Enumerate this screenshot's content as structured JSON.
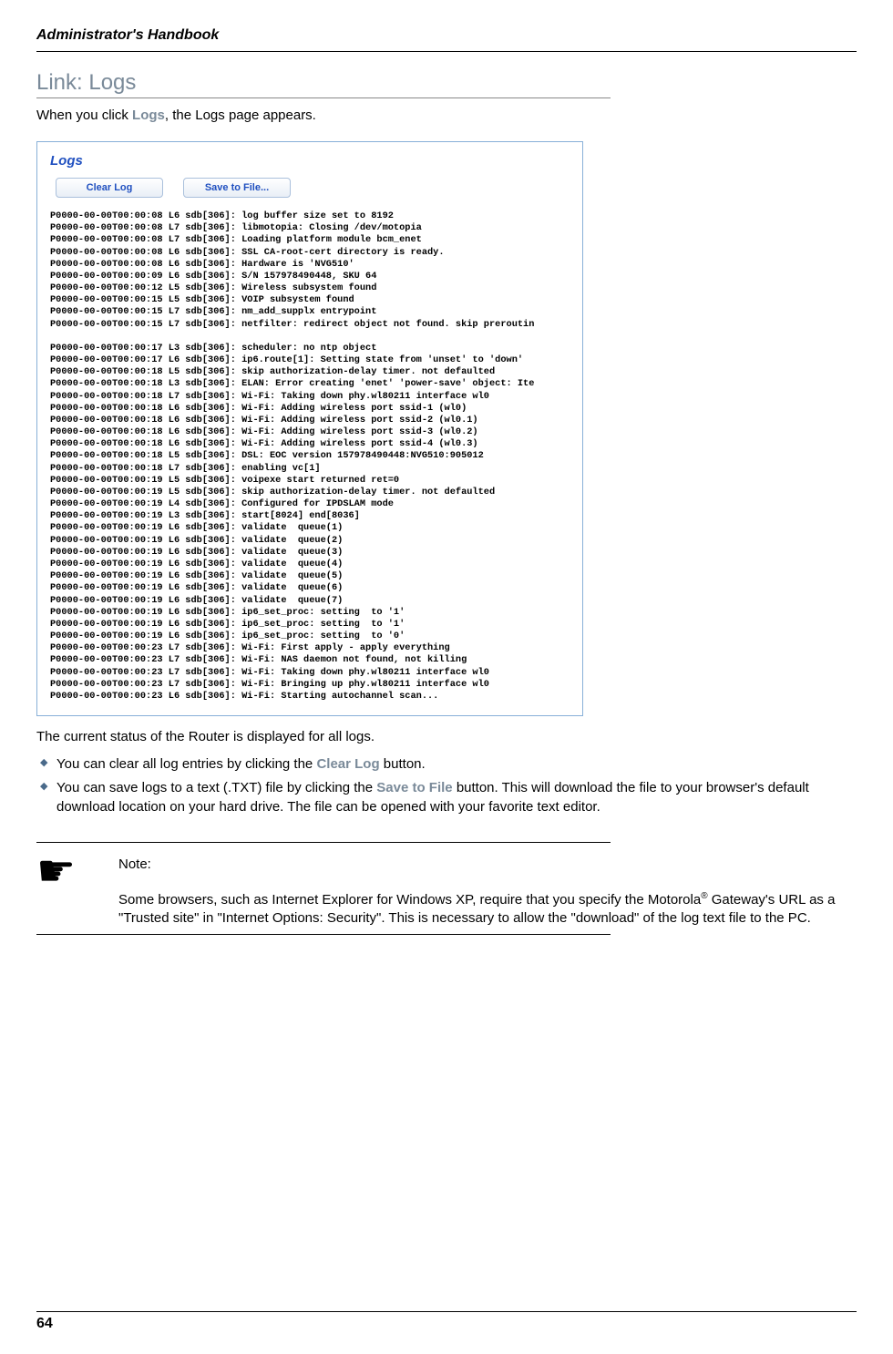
{
  "header": {
    "title": "Administrator's Handbook"
  },
  "section": {
    "heading": "Link: Logs",
    "intro_prefix": "When you click ",
    "intro_link": "Logs",
    "intro_suffix": ", the Logs page appears."
  },
  "screenshot": {
    "title": "Logs",
    "buttons": {
      "clear": "Clear Log",
      "save": "Save to File..."
    },
    "log_text": "P0000-00-00T00:00:08 L6 sdb[306]: log buffer size set to 8192\nP0000-00-00T00:00:08 L7 sdb[306]: libmotopia: Closing /dev/motopia\nP0000-00-00T00:00:08 L7 sdb[306]: Loading platform module bcm_enet\nP0000-00-00T00:00:08 L6 sdb[306]: SSL CA-root-cert directory is ready.\nP0000-00-00T00:00:08 L6 sdb[306]: Hardware is 'NVG510'\nP0000-00-00T00:00:09 L6 sdb[306]: S/N 157978490448, SKU 64\nP0000-00-00T00:00:12 L5 sdb[306]: Wireless subsystem found\nP0000-00-00T00:00:15 L5 sdb[306]: VOIP subsystem found\nP0000-00-00T00:00:15 L7 sdb[306]: nm_add_supplx entrypoint\nP0000-00-00T00:00:15 L7 sdb[306]: netfilter: redirect object not found. skip preroutin\n\nP0000-00-00T00:00:17 L3 sdb[306]: scheduler: no ntp object\nP0000-00-00T00:00:17 L6 sdb[306]: ip6.route[1]: Setting state from 'unset' to 'down'\nP0000-00-00T00:00:18 L5 sdb[306]: skip authorization-delay timer. not defaulted\nP0000-00-00T00:00:18 L3 sdb[306]: ELAN: Error creating 'enet' 'power-save' object: Ite\nP0000-00-00T00:00:18 L7 sdb[306]: Wi-Fi: Taking down phy.wl80211 interface wl0\nP0000-00-00T00:00:18 L6 sdb[306]: Wi-Fi: Adding wireless port ssid-1 (wl0)\nP0000-00-00T00:00:18 L6 sdb[306]: Wi-Fi: Adding wireless port ssid-2 (wl0.1)\nP0000-00-00T00:00:18 L6 sdb[306]: Wi-Fi: Adding wireless port ssid-3 (wl0.2)\nP0000-00-00T00:00:18 L6 sdb[306]: Wi-Fi: Adding wireless port ssid-4 (wl0.3)\nP0000-00-00T00:00:18 L5 sdb[306]: DSL: EOC version 157978490448:NVG510:905012\nP0000-00-00T00:00:18 L7 sdb[306]: enabling vc[1]\nP0000-00-00T00:00:19 L5 sdb[306]: voipexe start returned ret=0\nP0000-00-00T00:00:19 L5 sdb[306]: skip authorization-delay timer. not defaulted\nP0000-00-00T00:00:19 L4 sdb[306]: Configured for IPDSLAM mode\nP0000-00-00T00:00:19 L3 sdb[306]: start[8024] end[8036]\nP0000-00-00T00:00:19 L6 sdb[306]: validate  queue(1)\nP0000-00-00T00:00:19 L6 sdb[306]: validate  queue(2)\nP0000-00-00T00:00:19 L6 sdb[306]: validate  queue(3)\nP0000-00-00T00:00:19 L6 sdb[306]: validate  queue(4)\nP0000-00-00T00:00:19 L6 sdb[306]: validate  queue(5)\nP0000-00-00T00:00:19 L6 sdb[306]: validate  queue(6)\nP0000-00-00T00:00:19 L6 sdb[306]: validate  queue(7)\nP0000-00-00T00:00:19 L6 sdb[306]: ip6_set_proc: setting  to '1'\nP0000-00-00T00:00:19 L6 sdb[306]: ip6_set_proc: setting  to '1'\nP0000-00-00T00:00:19 L6 sdb[306]: ip6_set_proc: setting  to '0'\nP0000-00-00T00:00:23 L7 sdb[306]: Wi-Fi: First apply - apply everything\nP0000-00-00T00:00:23 L7 sdb[306]: Wi-Fi: NAS daemon not found, not killing\nP0000-00-00T00:00:23 L7 sdb[306]: Wi-Fi: Taking down phy.wl80211 interface wl0\nP0000-00-00T00:00:23 L7 sdb[306]: Wi-Fi: Bringing up phy.wl80211 interface wl0\nP0000-00-00T00:00:23 L6 sdb[306]: Wi-Fi: Starting autochannel scan..."
  },
  "status": "The current status of the Router is displayed for all logs.",
  "bullets": {
    "b1_prefix": "You can clear all log entries by clicking the ",
    "b1_link": "Clear Log",
    "b1_suffix": " button.",
    "b2_prefix": "You can save logs to a text (.TXT) file by clicking the ",
    "b2_link": "Save to File",
    "b2_suffix": " button. This will download the file to your browser's default download location on your hard drive. The file can be opened with your favorite text editor."
  },
  "note": {
    "label": "Note:",
    "body_prefix": "Some browsers, such as Internet Explorer for Windows XP, require that you specify the Motorola",
    "body_sup": "®",
    "body_suffix": " Gateway's URL as a \"Trusted site\" in \"Internet Options: Security\". This is necessary to allow the \"download\" of the log text file to the PC."
  },
  "footer": {
    "page": "64"
  }
}
